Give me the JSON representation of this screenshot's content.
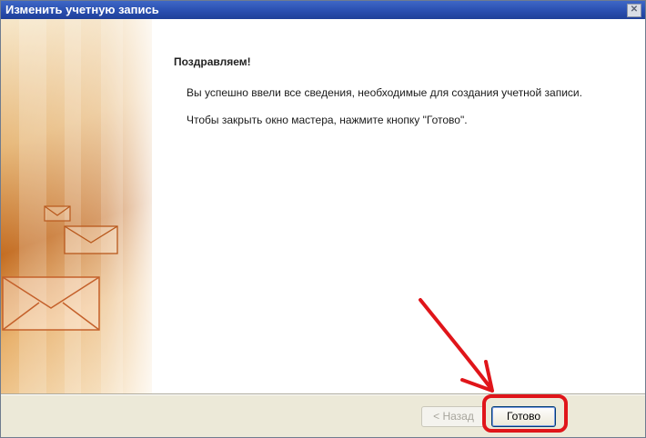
{
  "window": {
    "title": "Изменить учетную запись",
    "close_glyph": "✕"
  },
  "content": {
    "heading": "Поздравляем!",
    "paragraph_1": "Вы успешно ввели все сведения, необходимые для создания учетной записи.",
    "paragraph_2": "Чтобы закрыть окно мастера, нажмите кнопку \"Готово\"."
  },
  "footer": {
    "back_label": "< Назад",
    "done_label": "Готово"
  },
  "annotation": {
    "color": "#e0151a"
  }
}
